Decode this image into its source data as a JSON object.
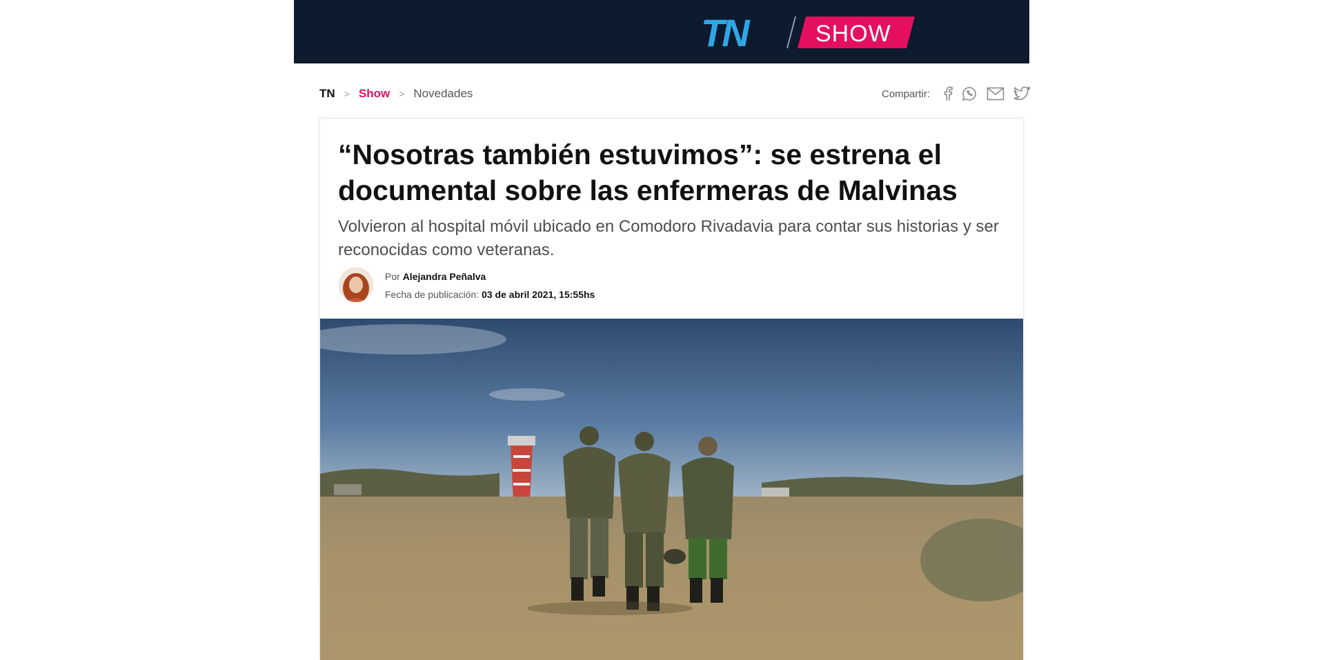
{
  "header": {
    "logo_tn": "TN",
    "logo_section": "SHOW",
    "colors": {
      "background": "#0e1a2e",
      "tn": "#2fa7e6",
      "show_badge": "#e4105f"
    }
  },
  "breadcrumb": {
    "home": "TN",
    "separator": ">",
    "section": "Show",
    "current": "Novedades"
  },
  "share": {
    "label": "Compartir:",
    "icons": [
      "facebook-icon",
      "whatsapp-icon",
      "email-icon",
      "twitter-icon"
    ]
  },
  "article": {
    "title": "“Nosotras también estuvimos”: se estrena el documental sobre las enfermeras de Malvinas",
    "subtitle": "Volvieron al hospital móvil ubicado en Comodoro Rivadavia para contar sus historias y ser reconocidas como veteranas.",
    "author_prefix": "Por",
    "author": "Alejandra Peñalva",
    "date_label": "Fecha de publicación:",
    "date": "03 de abril 2021, 15:55hs"
  }
}
